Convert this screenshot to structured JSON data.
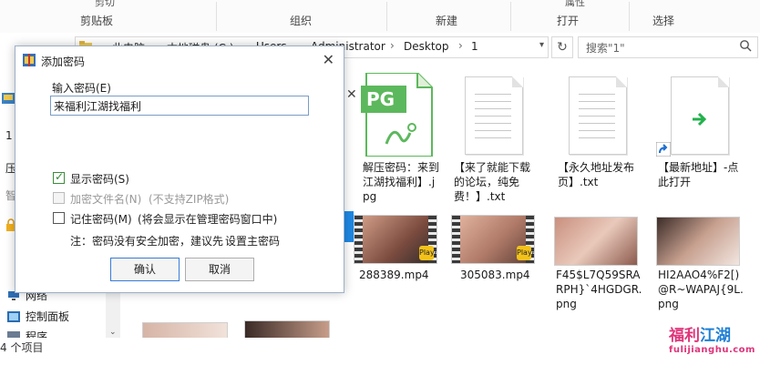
{
  "ribbon": {
    "groups": [
      "剪贴板",
      "组织",
      "新建",
      "打开",
      "选择"
    ],
    "cut_top_labels": [
      "剪切",
      "属性"
    ]
  },
  "address": {
    "crumbs": [
      "此电脑",
      "本地磁盘 (C:)",
      "Users",
      "Administrator",
      "Desktop",
      "1"
    ],
    "search_placeholder": "搜索\"1\""
  },
  "nav": {
    "items": [
      "网络",
      "控制面板",
      "程序"
    ],
    "partial_labels": [
      "1",
      "压",
      "智"
    ]
  },
  "status": {
    "text": "4 个项目"
  },
  "files": [
    {
      "name": "解压密码：来到江湖找福利】.jpg",
      "type": "jpg"
    },
    {
      "name": "【来了就能下载的论坛，纯免费！】.txt",
      "type": "txt"
    },
    {
      "name": "【永久地址发布页】.txt",
      "type": "txt"
    },
    {
      "name": "【最新地址】-点此打开",
      "type": "shortcut"
    },
    {
      "name": "288389.mp4",
      "type": "video"
    },
    {
      "name": "305083.mp4",
      "type": "video"
    },
    {
      "name": "F45$L7Q59SRARPH}`4HGDGR.png",
      "type": "png"
    },
    {
      "name": "HI2AAO4%F2[)@R~WAPAJ{9L.png",
      "type": "png"
    }
  ],
  "file_badges": {
    "player": "Player",
    "jpg_mark": "PG"
  },
  "dialog": {
    "title": "添加密码",
    "input_label": "输入密码(E)",
    "input_value": "来福利江湖找福利",
    "show_password": "显示密码(S)",
    "encrypt_names": "加密文件名(N)",
    "encrypt_names_note": "(不支持ZIP格式)",
    "remember": "记住密码(M)",
    "remember_note": "(将会显示在管理密码窗口中)",
    "note_prefix": "注：密码没有安全加密，建议先",
    "note_link": "设置主密码",
    "ok": "确认",
    "cancel": "取消"
  },
  "watermark": {
    "part1": "福利",
    "part2": "江湖",
    "domain": "fulijianghu.com"
  },
  "colors": {
    "accent": "#1a63c8",
    "check": "#2f8a2f",
    "watermark_pink": "#e0347a",
    "watermark_blue": "#1e7fd6"
  }
}
